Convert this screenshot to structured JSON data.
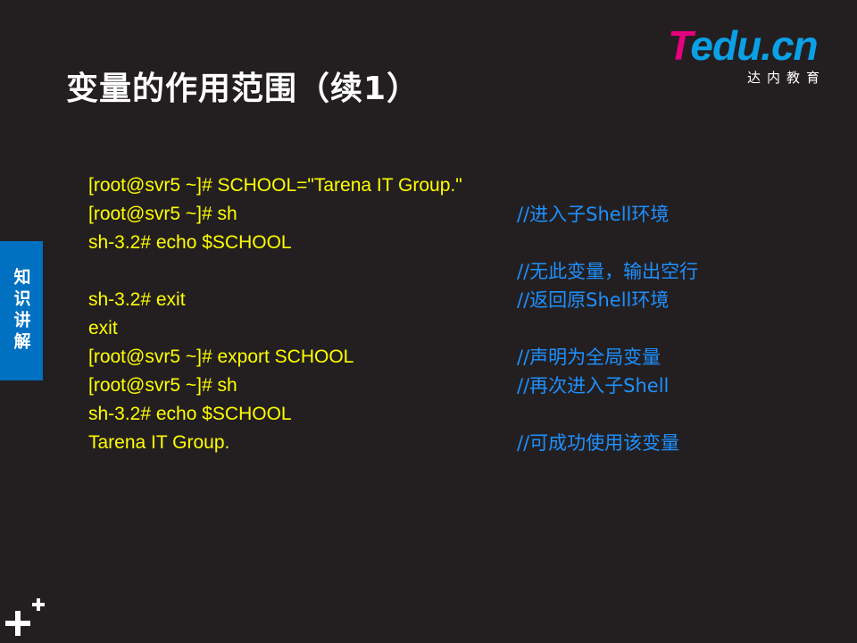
{
  "slide": {
    "title": "变量的作用范围（续1）",
    "side_tab": "知识讲解"
  },
  "logo": {
    "mark_first": "T",
    "mark_rest": "edu.cn",
    "subtitle": "达内教育"
  },
  "lines": [
    {
      "cmd": "[root@svr5 ~]# SCHOOL=\"Tarena IT Group.\"",
      "comment": ""
    },
    {
      "cmd": "[root@svr5 ~]# sh",
      "comment": "//进入子Shell环境"
    },
    {
      "cmd": "sh-3.2# echo $SCHOOL",
      "comment": ""
    },
    {
      "cmd": "",
      "comment": "//无此变量，输出空行"
    },
    {
      "cmd": "sh-3.2# exit",
      "comment": "//返回原Shell环境"
    },
    {
      "cmd": "exit",
      "comment": ""
    },
    {
      "cmd": "[root@svr5 ~]# export SCHOOL",
      "comment": "//声明为全局变量"
    },
    {
      "cmd": "[root@svr5 ~]# sh",
      "comment": "//再次进入子Shell"
    },
    {
      "cmd": "sh-3.2# echo $SCHOOL",
      "comment": ""
    },
    {
      "cmd": "Tarena IT Group.",
      "comment": "//可成功使用该变量"
    }
  ]
}
